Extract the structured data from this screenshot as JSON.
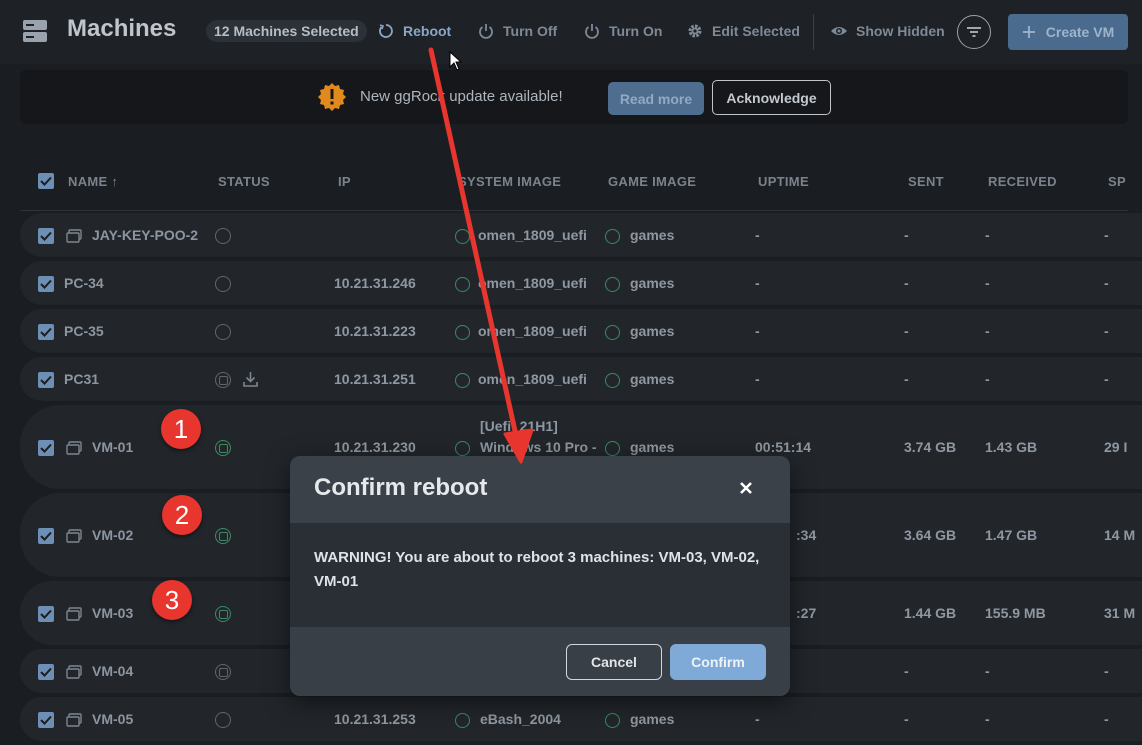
{
  "app": {
    "title": "Machines"
  },
  "toolbar": {
    "selected_badge": "12 Machines Selected",
    "reboot_label": "Reboot",
    "turn_off_label": "Turn Off",
    "turn_on_label": "Turn On",
    "edit_label": "Edit Selected",
    "show_hidden_label": "Show Hidden",
    "create_label": "Create VM",
    "colors": {
      "reboot": "#8aa7c8",
      "create_bg": "#4a6a8e"
    }
  },
  "banner": {
    "text": "New ggRock update available!",
    "read_more_label": "Read more",
    "acknowledge_label": "Acknowledge"
  },
  "table": {
    "columns": [
      "NAME",
      "STATUS",
      "IP",
      "SYSTEM IMAGE",
      "GAME IMAGE",
      "UPTIME",
      "SENT",
      "RECEIVED",
      "SP"
    ],
    "sort_indicator": "↑",
    "rows": [
      {
        "name": "JAY-KEY-POO-2",
        "ip": "",
        "system_image": "omen_1809_uefi",
        "game_image": "games",
        "uptime": "-",
        "sent": "-",
        "received": "-",
        "speed": "-"
      },
      {
        "name": "PC-34",
        "ip": "10.21.31.246",
        "system_image": "omen_1809_uefi",
        "game_image": "games",
        "uptime": "-",
        "sent": "-",
        "received": "-",
        "speed": "-"
      },
      {
        "name": "PC-35",
        "ip": "10.21.31.223",
        "system_image": "omen_1809_uefi",
        "game_image": "games",
        "uptime": "-",
        "sent": "-",
        "received": "-",
        "speed": "-"
      },
      {
        "name": "PC31",
        "ip": "10.21.31.251",
        "system_image": "omen_1809_uefi",
        "game_image": "games",
        "uptime": "-",
        "sent": "-",
        "received": "-",
        "speed": "-"
      },
      {
        "name": "VM-01",
        "ip": "10.21.31.230",
        "system_image_line1": "[Uefi] 21H1]",
        "system_image": "Windows 10 Pro -",
        "game_image": "games",
        "uptime": "00:51:14",
        "sent": "3.74 GB",
        "received": "1.43 GB",
        "speed": "29 I"
      },
      {
        "name": "VM-02",
        "ip": "",
        "system_image": "",
        "game_image": "",
        "uptime": ":34",
        "sent": "3.64 GB",
        "received": "1.47 GB",
        "speed": "14 M"
      },
      {
        "name": "VM-03",
        "ip": "",
        "system_image": "",
        "game_image": "",
        "uptime": ":27",
        "sent": "1.44 GB",
        "received": "155.9 MB",
        "speed": "31 M"
      },
      {
        "name": "VM-04",
        "ip": "",
        "system_image": "",
        "game_image": "",
        "uptime": "",
        "sent": "-",
        "received": "-",
        "speed": "-"
      },
      {
        "name": "VM-05",
        "ip": "10.21.31.253",
        "system_image": "eBash_2004",
        "game_image": "games",
        "uptime": "-",
        "sent": "-",
        "received": "-",
        "speed": "-"
      }
    ]
  },
  "modal": {
    "title": "Confirm reboot",
    "message": "WARNING! You are about to reboot 3 machines: VM-03, VM-02, VM-01",
    "cancel_label": "Cancel",
    "confirm_label": "Confirm"
  },
  "annotations": {
    "badges": [
      "1",
      "2",
      "3"
    ],
    "color": "#e8362f"
  }
}
